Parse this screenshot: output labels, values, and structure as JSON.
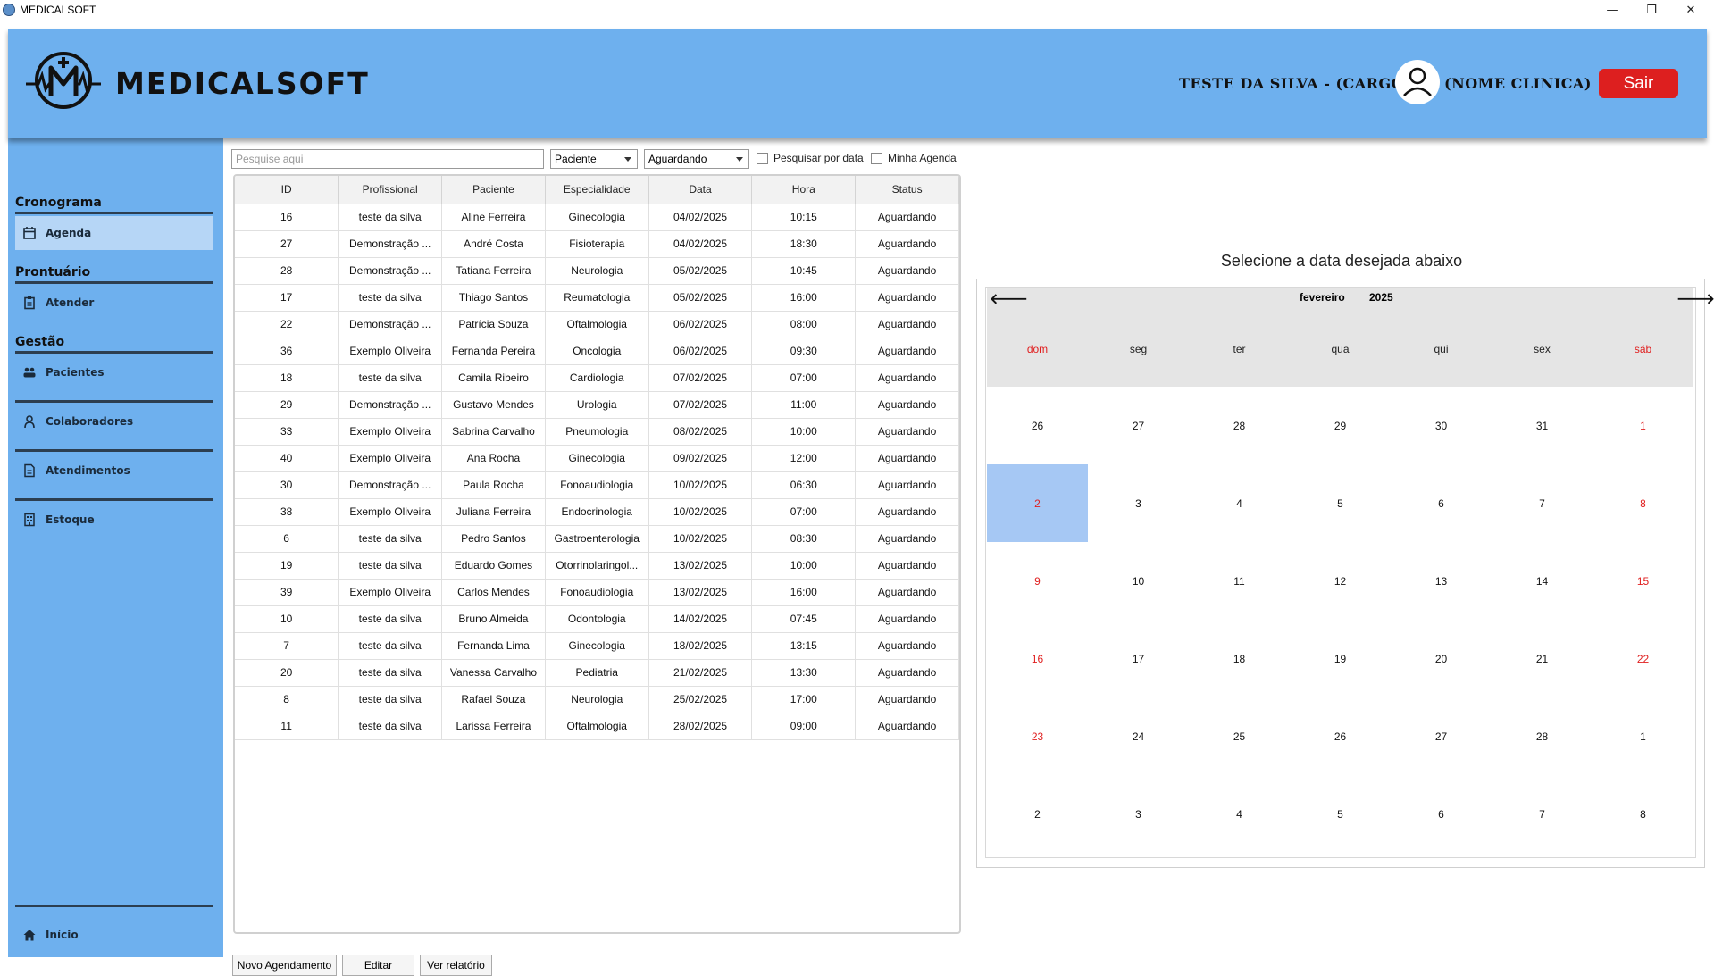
{
  "window": {
    "title": "MEDICALSOFT",
    "controls": {
      "minimize": "—",
      "restore": "❐",
      "close": "✕"
    }
  },
  "header": {
    "brand": "MEDICALSOFT",
    "user": "TESTE DA SILVA  - (CARGO)",
    "clinic": "(NOME CLINICA)",
    "logout": "Sair"
  },
  "sidebar": {
    "sections": {
      "cronograma": "Cronograma",
      "prontuario": "Prontuário",
      "gestao": "Gestão"
    },
    "items": {
      "agenda": "Agenda",
      "atender": "Atender",
      "pacientes": "Pacientes",
      "colaboradores": "Colaboradores",
      "atendimentos": "Atendimentos",
      "estoque": "Estoque",
      "inicio": "Início"
    }
  },
  "filters": {
    "search_placeholder": "Pesquise aqui",
    "field_select": "Paciente",
    "status_select": "Aguardando",
    "by_date": "Pesquisar por data",
    "my_agenda": "Minha Agenda"
  },
  "table": {
    "headers": [
      "ID",
      "Profissional",
      "Paciente",
      "Especialidade",
      "Data",
      "Hora",
      "Status"
    ],
    "rows": [
      [
        "16",
        "teste da silva",
        "Aline Ferreira",
        "Ginecologia",
        "04/02/2025",
        "10:15",
        "Aguardando"
      ],
      [
        "27",
        "Demonstração ...",
        "André Costa",
        "Fisioterapia",
        "04/02/2025",
        "18:30",
        "Aguardando"
      ],
      [
        "28",
        "Demonstração ...",
        "Tatiana Ferreira",
        "Neurologia",
        "05/02/2025",
        "10:45",
        "Aguardando"
      ],
      [
        "17",
        "teste da silva",
        "Thiago Santos",
        "Reumatologia",
        "05/02/2025",
        "16:00",
        "Aguardando"
      ],
      [
        "22",
        "Demonstração ...",
        "Patrícia Souza",
        "Oftalmologia",
        "06/02/2025",
        "08:00",
        "Aguardando"
      ],
      [
        "36",
        "Exemplo Oliveira",
        "Fernanda Pereira",
        "Oncologia",
        "06/02/2025",
        "09:30",
        "Aguardando"
      ],
      [
        "18",
        "teste da silva",
        "Camila Ribeiro",
        "Cardiologia",
        "07/02/2025",
        "07:00",
        "Aguardando"
      ],
      [
        "29",
        "Demonstração ...",
        "Gustavo Mendes",
        "Urologia",
        "07/02/2025",
        "11:00",
        "Aguardando"
      ],
      [
        "33",
        "Exemplo Oliveira",
        "Sabrina Carvalho",
        "Pneumologia",
        "08/02/2025",
        "10:00",
        "Aguardando"
      ],
      [
        "40",
        "Exemplo Oliveira",
        "Ana Rocha",
        "Ginecologia",
        "09/02/2025",
        "12:00",
        "Aguardando"
      ],
      [
        "30",
        "Demonstração ...",
        "Paula Rocha",
        "Fonoaudiologia",
        "10/02/2025",
        "06:30",
        "Aguardando"
      ],
      [
        "38",
        "Exemplo Oliveira",
        "Juliana Ferreira",
        "Endocrinologia",
        "10/02/2025",
        "07:00",
        "Aguardando"
      ],
      [
        "6",
        "teste da silva",
        "Pedro Santos",
        "Gastroenterologia",
        "10/02/2025",
        "08:30",
        "Aguardando"
      ],
      [
        "19",
        "teste da silva",
        "Eduardo Gomes",
        "Otorrinolaringol...",
        "13/02/2025",
        "10:00",
        "Aguardando"
      ],
      [
        "39",
        "Exemplo Oliveira",
        "Carlos Mendes",
        "Fonoaudiologia",
        "13/02/2025",
        "16:00",
        "Aguardando"
      ],
      [
        "10",
        "teste da silva",
        "Bruno Almeida",
        "Odontologia",
        "14/02/2025",
        "07:45",
        "Aguardando"
      ],
      [
        "7",
        "teste da silva",
        "Fernanda Lima",
        "Ginecologia",
        "18/02/2025",
        "13:15",
        "Aguardando"
      ],
      [
        "20",
        "teste da silva",
        "Vanessa Carvalho",
        "Pediatria",
        "21/02/2025",
        "13:30",
        "Aguardando"
      ],
      [
        "8",
        "teste da silva",
        "Rafael Souza",
        "Neurologia",
        "25/02/2025",
        "17:00",
        "Aguardando"
      ],
      [
        "11",
        "teste da silva",
        "Larissa Ferreira",
        "Oftalmologia",
        "28/02/2025",
        "09:00",
        "Aguardando"
      ]
    ]
  },
  "actions": {
    "new": "Novo Agendamento",
    "edit": "Editar",
    "report": "Ver relatório"
  },
  "calendar": {
    "title": "Selecione a data desejada abaixo",
    "month": "fevereiro",
    "year": "2025",
    "prev_icon": "arrow-left-icon",
    "next_icon": "arrow-right-icon",
    "weekdays": [
      "dom",
      "seg",
      "ter",
      "qua",
      "qui",
      "sex",
      "sáb"
    ],
    "days": [
      "26",
      "27",
      "28",
      "29",
      "30",
      "31",
      "1",
      "2",
      "3",
      "4",
      "5",
      "6",
      "7",
      "8",
      "9",
      "10",
      "11",
      "12",
      "13",
      "14",
      "15",
      "16",
      "17",
      "18",
      "19",
      "20",
      "21",
      "22",
      "23",
      "24",
      "25",
      "26",
      "27",
      "28",
      "1",
      "2",
      "3",
      "4",
      "5",
      "6",
      "7",
      "8"
    ],
    "selected_day": "2",
    "weekend_color": "#e02020",
    "selected_color": "#a6c8f4"
  },
  "colors": {
    "header_bg": "#6eb0ee",
    "logout_bg": "#dd1f1f",
    "active_item_bg": "#b6d6f6"
  }
}
